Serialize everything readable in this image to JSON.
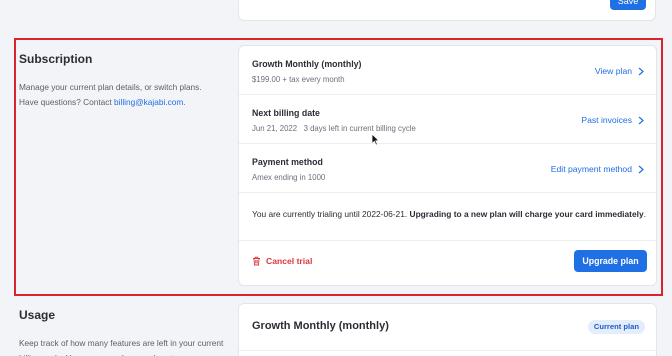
{
  "top_card": {
    "save_label": "Save"
  },
  "subscription_section": {
    "title": "Subscription",
    "description_line1": "Manage your current plan details, or switch plans.",
    "description_line2_prefix": "Have questions? Contact ",
    "contact_email": "billing@kajabi.com",
    "description_line2_suffix": "."
  },
  "subscription_card": {
    "plan": {
      "title": "Growth Monthly (monthly)",
      "subtitle": "$199.00 + tax every month",
      "link_label": "View plan"
    },
    "billing": {
      "title": "Next billing date",
      "subtitle": "Jun 21, 2022   3 days left in current billing cycle",
      "link_label": "Past invoices"
    },
    "payment": {
      "title": "Payment method",
      "subtitle": "Amex ending in 1000",
      "link_label": "Edit payment method"
    },
    "trial_note_prefix": "You are currently trialing until 2022-06-21. ",
    "trial_note_bold": "Upgrading to a new plan will charge your card immediately",
    "trial_note_suffix": ".",
    "cancel_label": "Cancel trial",
    "upgrade_label": "Upgrade plan"
  },
  "usage_section": {
    "title": "Usage",
    "description": "Keep track of how many features are left in your current billing cycle. You can upgrade your plan at"
  },
  "usage_card": {
    "plan_title": "Growth Monthly (monthly)",
    "badge": "Current plan"
  },
  "colors": {
    "accent": "#1f6fe5",
    "danger": "#d9373e",
    "highlight_border": "#d9242b",
    "background": "#f3f4f7"
  },
  "icons": [
    "chevron-right-icon",
    "trash-icon",
    "mouse-cursor-icon"
  ]
}
